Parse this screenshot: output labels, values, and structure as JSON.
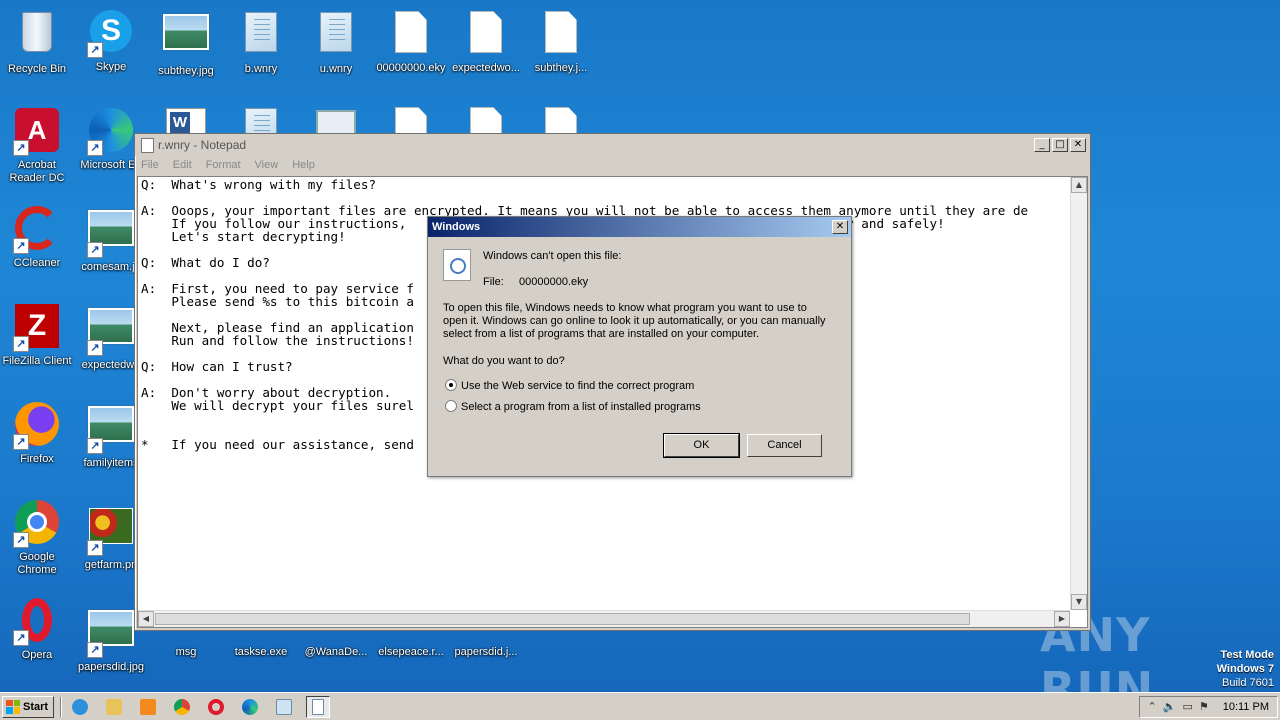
{
  "desktop": {
    "icons": [
      {
        "label": "Recycle Bin"
      },
      {
        "label": "Skype"
      },
      {
        "label": "subthey.jpg"
      },
      {
        "label": "b.wnry"
      },
      {
        "label": "u.wnry"
      },
      {
        "label": "00000000.eky"
      },
      {
        "label": "expectedwo..."
      },
      {
        "label": "subthey.j..."
      },
      {
        "label": "Acrobat Reader DC"
      },
      {
        "label": "Microsoft Ed"
      },
      {
        "label": "CCleaner"
      },
      {
        "label": "comesam.jp"
      },
      {
        "label": "FileZilla Client"
      },
      {
        "label": "expectedwo"
      },
      {
        "label": "Firefox"
      },
      {
        "label": "familyitems"
      },
      {
        "label": "Google Chrome"
      },
      {
        "label": "getfarm.pn"
      },
      {
        "label": "Opera"
      },
      {
        "label": "papersdid.jpg"
      },
      {
        "label": "msg"
      },
      {
        "label": "taskse.exe"
      },
      {
        "label": "@WanaDe..."
      },
      {
        "label": "elsepeace.r..."
      },
      {
        "label": "papersdid.j..."
      }
    ]
  },
  "notepad": {
    "title": "r.wnry - Notepad",
    "menu": [
      "File",
      "Edit",
      "Format",
      "View",
      "Help"
    ],
    "content": "Q:  What's wrong with my files?\n\nA:  Ooops, your important files are encrypted. It means you will not be able to access them anymore until they are de\n    If you follow our instructions,                                                        kly and safely!\n    Let's start decrypting!\n\nQ:  What do I do?\n\nA:  First, you need to pay service f\n    Please send %s to this bitcoin a\n\n    Next, please find an application\n    Run and follow the instructions!                                                 )\n\nQ:  How can I trust?\n\nA:  Don't worry about decryption.\n    We will decrypt your files surel\n\n\n*   If you need our assistance, send                                                 window."
  },
  "dialog": {
    "title": "Windows",
    "heading": "Windows can't open this file:",
    "file_label": "File:",
    "file_name": "00000000.eky",
    "description_lines": [
      "To open this file, Windows needs to know what program you want to use to",
      "open it. Windows can go online to look it up automatically, or you can manually",
      "select from a list of programs that are installed on your computer."
    ],
    "question": "What do you want to do?",
    "option_web": "Use the Web service to find the correct program",
    "option_list": "Select a program from a list of installed programs",
    "ok_label": "OK",
    "cancel_label": "Cancel"
  },
  "watermark": {
    "text": "ANY RUN"
  },
  "test_mode": {
    "line1": "Test Mode",
    "line2": "Windows 7",
    "line3": "Build 7601"
  },
  "taskbar": {
    "start_label": "Start",
    "clock": "10:11 PM"
  }
}
